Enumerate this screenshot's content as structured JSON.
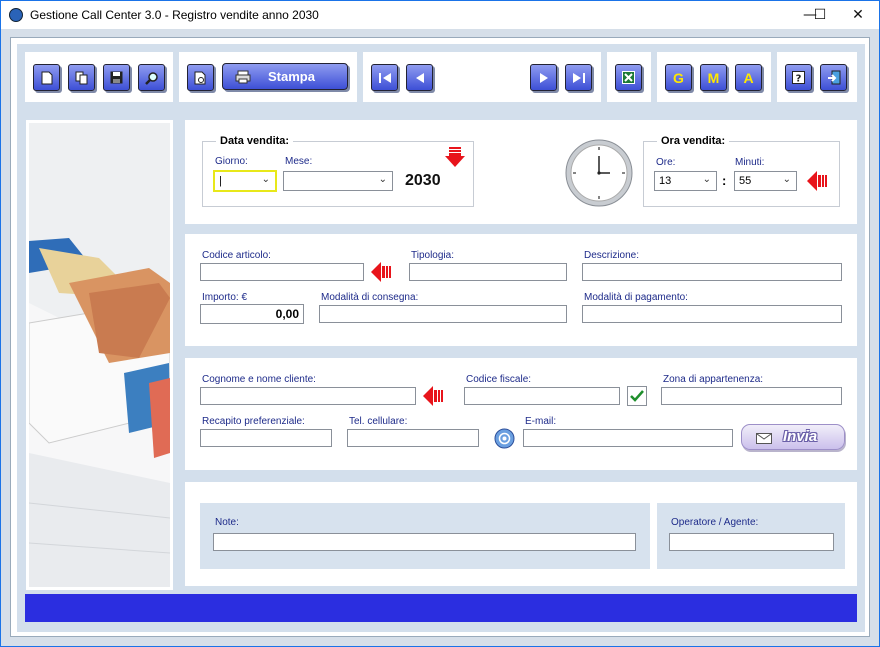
{
  "window": {
    "title": "Gestione Call Center 3.0 - Registro vendite anno 2030",
    "minimize_glyph": "—",
    "maximize_glyph": "☐",
    "close_glyph": "✕"
  },
  "toolbar": {
    "stampa_label": "Stampa",
    "letters": [
      "G",
      "M",
      "A"
    ],
    "icons": [
      "new-record-icon",
      "copy-record-icon",
      "save-icon",
      "search-icon",
      "print-preview-icon",
      "printer-icon",
      "first-record-icon",
      "previous-record-icon",
      "next-record-icon",
      "last-record-icon",
      "excel-icon",
      "help-icon",
      "exit-icon"
    ]
  },
  "date_section": {
    "title": "Data vendita:",
    "giorno_label": "Giorno:",
    "giorno_value": "|",
    "mese_label": "Mese:",
    "mese_value": "",
    "year": "2030"
  },
  "time_section": {
    "title": "Ora vendita:",
    "ore_label": "Ore:",
    "ore_value": "13",
    "separator": ":",
    "minuti_label": "Minuti:",
    "minuti_value": "55"
  },
  "article": {
    "codice_label": "Codice articolo:",
    "tipologia_label": "Tipologia:",
    "descrizione_label": "Descrizione:",
    "importo_label": "Importo: €",
    "importo_value": "0,00",
    "consegna_label": "Modalità di consegna:",
    "pagamento_label": "Modalità di pagamento:"
  },
  "client": {
    "nome_label": "Cognome e nome cliente:",
    "cf_label": "Codice fiscale:",
    "zona_label": "Zona di appartenenza:",
    "recapito_label": "Recapito preferenziale:",
    "cell_label": "Tel. cellulare:",
    "email_label": "E-mail:",
    "invia_label": "Invia"
  },
  "notes": {
    "note_label": "Note:",
    "operatore_label": "Operatore / Agente:"
  },
  "colors": {
    "accent": "#3d4fd6",
    "status_bar": "#2b2ee0",
    "arrow_red": "#e8141b",
    "label_blue": "#1e2b8a"
  }
}
